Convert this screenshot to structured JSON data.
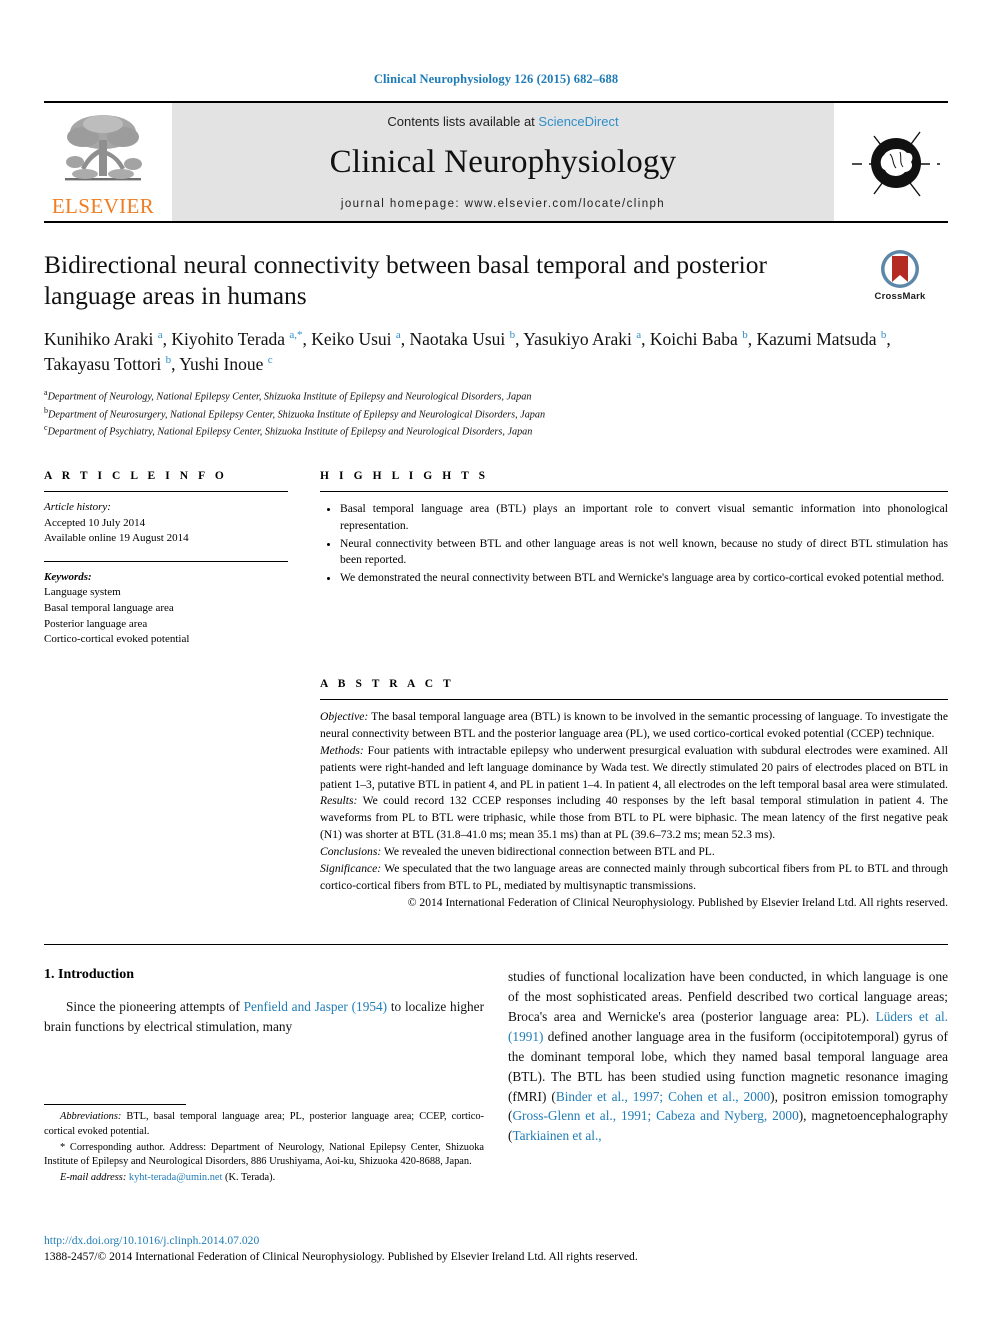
{
  "running_head": "Clinical Neurophysiology 126 (2015) 682–688",
  "masthead": {
    "contents_prefix": "Contents lists available at ",
    "sciencedirect": "ScienceDirect",
    "journal_title": "Clinical Neurophysiology",
    "homepage": "journal homepage: www.elsevier.com/locate/clinph",
    "publisher_wordmark": "ELSEVIER"
  },
  "article": {
    "title": "Bidirectional neural connectivity between basal temporal and posterior language areas in humans",
    "crossmark_label": "CrossMark",
    "authors_html": "Kunihiko Araki <sup>a</sup>, Kiyohito Terada <sup>a,*</sup>, Keiko Usui <sup>a</sup>, Naotaka Usui <sup>b</sup>, Yasukiyo Araki <sup>a</sup>, Koichi Baba <sup>b</sup>, Kazumi Matsuda <sup>b</sup>, Takayasu Tottori <sup>b</sup>, Yushi Inoue <sup>c</sup>",
    "affiliations": [
      {
        "mark": "a",
        "text": "Department of Neurology, National Epilepsy Center, Shizuoka Institute of Epilepsy and Neurological Disorders, Japan"
      },
      {
        "mark": "b",
        "text": "Department of Neurosurgery, National Epilepsy Center, Shizuoka Institute of Epilepsy and Neurological Disorders, Japan"
      },
      {
        "mark": "c",
        "text": "Department of Psychiatry, National Epilepsy Center, Shizuoka Institute of Epilepsy and Neurological Disorders, Japan"
      }
    ]
  },
  "article_info": {
    "heading": "A R T I C L E  I N F O",
    "history_label": "Article history:",
    "history": [
      "Accepted 10 July 2014",
      "Available online 19 August 2014"
    ],
    "keywords_label": "Keywords:",
    "keywords": [
      "Language system",
      "Basal temporal language area",
      "Posterior language area",
      "Cortico-cortical evoked potential"
    ]
  },
  "highlights": {
    "heading": "H I G H L I G H T S",
    "items": [
      "Basal temporal language area (BTL) plays an important role to convert visual semantic information into phonological representation.",
      "Neural connectivity between BTL and other language areas is not well known, because no study of direct BTL stimulation has been reported.",
      "We demonstrated the neural connectivity between BTL and Wernicke's language area by cortico-cortical evoked potential method."
    ]
  },
  "abstract": {
    "heading": "A B S T R A C T",
    "sections": [
      {
        "label": "Objective:",
        "text": " The basal temporal language area (BTL) is known to be involved in the semantic processing of language. To investigate the neural connectivity between BTL and the posterior language area (PL), we used cortico-cortical evoked potential (CCEP) technique."
      },
      {
        "label": "Methods:",
        "text": " Four patients with intractable epilepsy who underwent presurgical evaluation with subdural electrodes were examined. All patients were right-handed and left language dominance by Wada test. We directly stimulated 20 pairs of electrodes placed on BTL in patient 1–3, putative BTL in patient 4, and PL in patient 1–4. In patient 4, all electrodes on the left temporal basal area were stimulated."
      },
      {
        "label": "Results:",
        "text": " We could record 132 CCEP responses including 40 responses by the left basal temporal stimulation in patient 4. The waveforms from PL to BTL were triphasic, while those from BTL to PL were biphasic. The mean latency of the first negative peak (N1) was shorter at BTL (31.8–41.0 ms; mean 35.1 ms) than at PL (39.6–73.2 ms; mean 52.3 ms)."
      },
      {
        "label": "Conclusions:",
        "text": " We revealed the uneven bidirectional connection between BTL and PL."
      },
      {
        "label": "Significance:",
        "text": " We speculated that the two language areas are connected mainly through subcortical fibers from PL to BTL and through cortico-cortical fibers from BTL to PL, mediated by multisynaptic transmissions."
      }
    ],
    "copyright": "© 2014 International Federation of Clinical Neurophysiology. Published by Elsevier Ireland Ltd. All rights reserved."
  },
  "introduction": {
    "heading": "1. Introduction",
    "left_para_pre": "Since the pioneering attempts of ",
    "left_link": "Penfield and Jasper (1954)",
    "left_para_post": " to localize higher brain functions by electrical stimulation, many",
    "right_para_1": "studies of functional localization have been conducted, in which language is one of the most sophisticated areas. Penfield described two cortical language areas; Broca's area and Wernicke's area (posterior language area: PL). ",
    "right_link_1": "Lüders et al. (1991)",
    "right_para_2": " defined another language area in the fusiform (occipitotemporal) gyrus of the dominant temporal lobe, which they named basal temporal language area (BTL). The BTL has been studied using function magnetic resonance imaging (fMRI) (",
    "right_link_2": "Binder et al., 1997; Cohen et al., 2000",
    "right_para_3": "), positron emission tomography (",
    "right_link_3": "Gross-Glenn et al., 1991; Cabeza and Nyberg, 2000",
    "right_para_4": "), magnetoencephalography (",
    "right_link_4": "Tarkiainen et al.,"
  },
  "footnotes": {
    "abbreviations_label": "Abbreviations:",
    "abbreviations_text": " BTL, basal temporal language area; PL, posterior language area; CCEP, cortico-cortical evoked potential.",
    "corresponding": "* Corresponding author. Address: Department of Neurology, National Epilepsy Center, Shizuoka Institute of Epilepsy and Neurological Disorders, 886 Urushiyama, Aoi-ku, Shizuoka 420-8688, Japan.",
    "email_label": "E-mail address:",
    "email": "kyht-terada@umin.net",
    "email_suffix": " (K. Terada)."
  },
  "page_footer": {
    "doi": "http://dx.doi.org/10.1016/j.clinph.2014.07.020",
    "issn_line": "1388-2457/© 2014 International Federation of Clinical Neurophysiology. Published by Elsevier Ireland Ltd. All rights reserved."
  },
  "colors": {
    "link": "#1f7bb6",
    "elsevier_orange": "#ef7d22",
    "masthead_gray": "#e3e3e3",
    "crossmark_red": "#b32b23",
    "crossmark_blue": "#5d87a8"
  }
}
